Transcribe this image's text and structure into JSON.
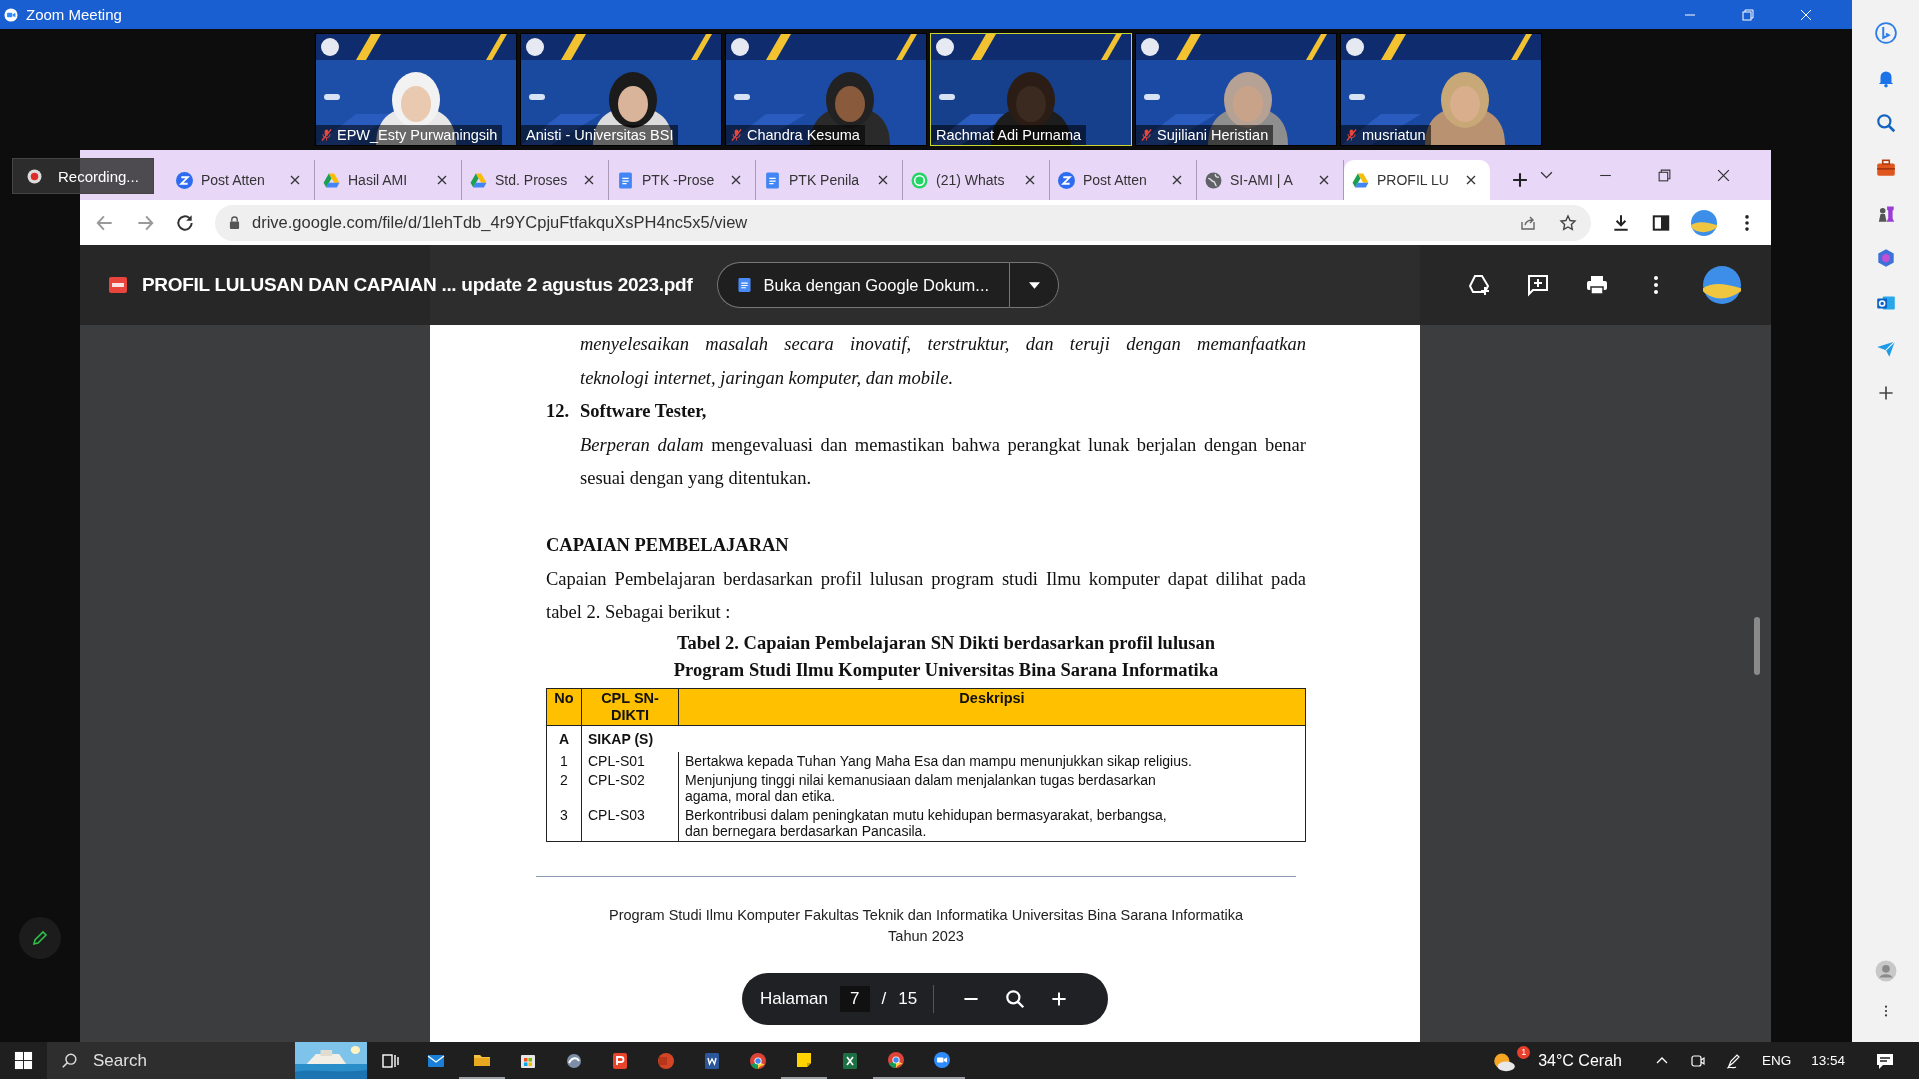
{
  "zoom_window": {
    "title": "Zoom Meeting"
  },
  "participants": [
    {
      "name": "EPW_Esty Purwaningsih",
      "muted": true,
      "speaking": false
    },
    {
      "name": "Anisti - Universitas BSI",
      "muted": false,
      "speaking": false
    },
    {
      "name": "Chandra Kesuma",
      "muted": true,
      "speaking": false
    },
    {
      "name": "Rachmat Adi Purnama",
      "muted": false,
      "speaking": true
    },
    {
      "name": "Sujiliani Heristian",
      "muted": true,
      "speaking": false
    },
    {
      "name": "musriatun",
      "muted": true,
      "speaking": false
    }
  ],
  "recording": {
    "label": "Recording..."
  },
  "browser": {
    "tabs": [
      {
        "title": "Post Atten",
        "kind": "zoom",
        "selected": false
      },
      {
        "title": "Hasil AMI",
        "kind": "drive",
        "selected": false
      },
      {
        "title": "Std. Proses",
        "kind": "drive",
        "selected": false
      },
      {
        "title": "PTK -Prose",
        "kind": "docs",
        "selected": false
      },
      {
        "title": "PTK Penila",
        "kind": "docs",
        "selected": false
      },
      {
        "title": "(21) Whats",
        "kind": "whatsapp",
        "selected": false
      },
      {
        "title": "Post Atten",
        "kind": "zoom",
        "selected": false
      },
      {
        "title": "SI-AMI | A",
        "kind": "globe",
        "selected": false
      },
      {
        "title": "PROFIL LU",
        "kind": "drive",
        "selected": true
      }
    ],
    "url": "drive.google.com/file/d/1lehTdb_4r9YCpjuFtfakquXsPH4nc5x5/view"
  },
  "viewer": {
    "file_name": "PROFIL LULUSAN DAN CAPAIAN ... update 2 agustus 2023.pdf",
    "open_with": "Buka dengan Google Dokum...",
    "page_label": "Halaman",
    "page": "7",
    "page_separator": "/",
    "page_count": "15"
  },
  "document": {
    "continuation_lines": [
      "menyelesaikan masalah secara inovatif, terstruktur, dan teruji dengan memanfaatkan",
      "teknologi internet, jaringan komputer, dan mobile."
    ],
    "item": {
      "number": "12.",
      "title": "Software Tester,",
      "lines": [
        "*Berperan dalam* mengevaluasi dan memastikan bahwa perangkat lunak berjalan dengan benar",
        "sesuai dengan yang ditentukan."
      ]
    },
    "heading": "CAPAIAN PEMBELAJARAN",
    "paragraph_lines": [
      "Capaian Pembelajaran berdasarkan profil lulusan program studi Ilmu komputer dapat dilihat pada",
      "tabel 2. Sebagai berikut :"
    ],
    "table_caption": [
      "Tabel 2. Capaian Pembelajaran SN Dikti berdasarkan profil lulusan",
      "Program Studi Ilmu Komputer Universitas Bina Sarana Informatika"
    ],
    "table": {
      "columns": [
        "No",
        "CPL SN-DIKTI",
        "Deskripsi"
      ],
      "rows": [
        {
          "kind": "group",
          "no": "A",
          "label": "SIKAP (S)"
        },
        {
          "kind": "item",
          "no": "1",
          "code": "CPL-S01",
          "description": [
            "Bertakwa kepada Tuhan Yang Maha Esa dan mampu menunjukkan sikap religius."
          ]
        },
        {
          "kind": "item",
          "no": "2",
          "code": "CPL-S02",
          "description": [
            "Menjunjung tinggi nilai kemanusiaan dalam menjalankan tugas berdasarkan",
            "agama, moral dan etika."
          ]
        },
        {
          "kind": "item",
          "no": "3",
          "code": "CPL-S03",
          "description": [
            "Berkontribusi dalam peningkatan mutu kehidupan bermasyarakat, berbangsa,",
            "dan bernegara berdasarkan Pancasila."
          ]
        }
      ]
    },
    "footer": [
      "Program Studi Ilmu Komputer Fakultas Teknik dan Informatika Universitas Bina Sarana Informatika",
      "Tahun 2023"
    ]
  },
  "taskbar": {
    "search_placeholder": "Search",
    "apps": [
      {
        "kind": "task-view",
        "running": false
      },
      {
        "kind": "mail",
        "running": false
      },
      {
        "kind": "folder",
        "running": true
      },
      {
        "kind": "store",
        "running": false
      },
      {
        "kind": "app",
        "running": false
      },
      {
        "kind": "wps",
        "running": false
      },
      {
        "kind": "slides",
        "running": false
      },
      {
        "kind": "word",
        "running": false
      },
      {
        "kind": "chrome",
        "running": false
      },
      {
        "kind": "notes",
        "running": true
      },
      {
        "kind": "excel",
        "running": false
      },
      {
        "kind": "chrome",
        "running": true
      },
      {
        "kind": "zoom",
        "running": true
      }
    ],
    "weather_badge": "1",
    "weather": "34°C Cerah",
    "language": "ENG",
    "time": "13:54"
  }
}
